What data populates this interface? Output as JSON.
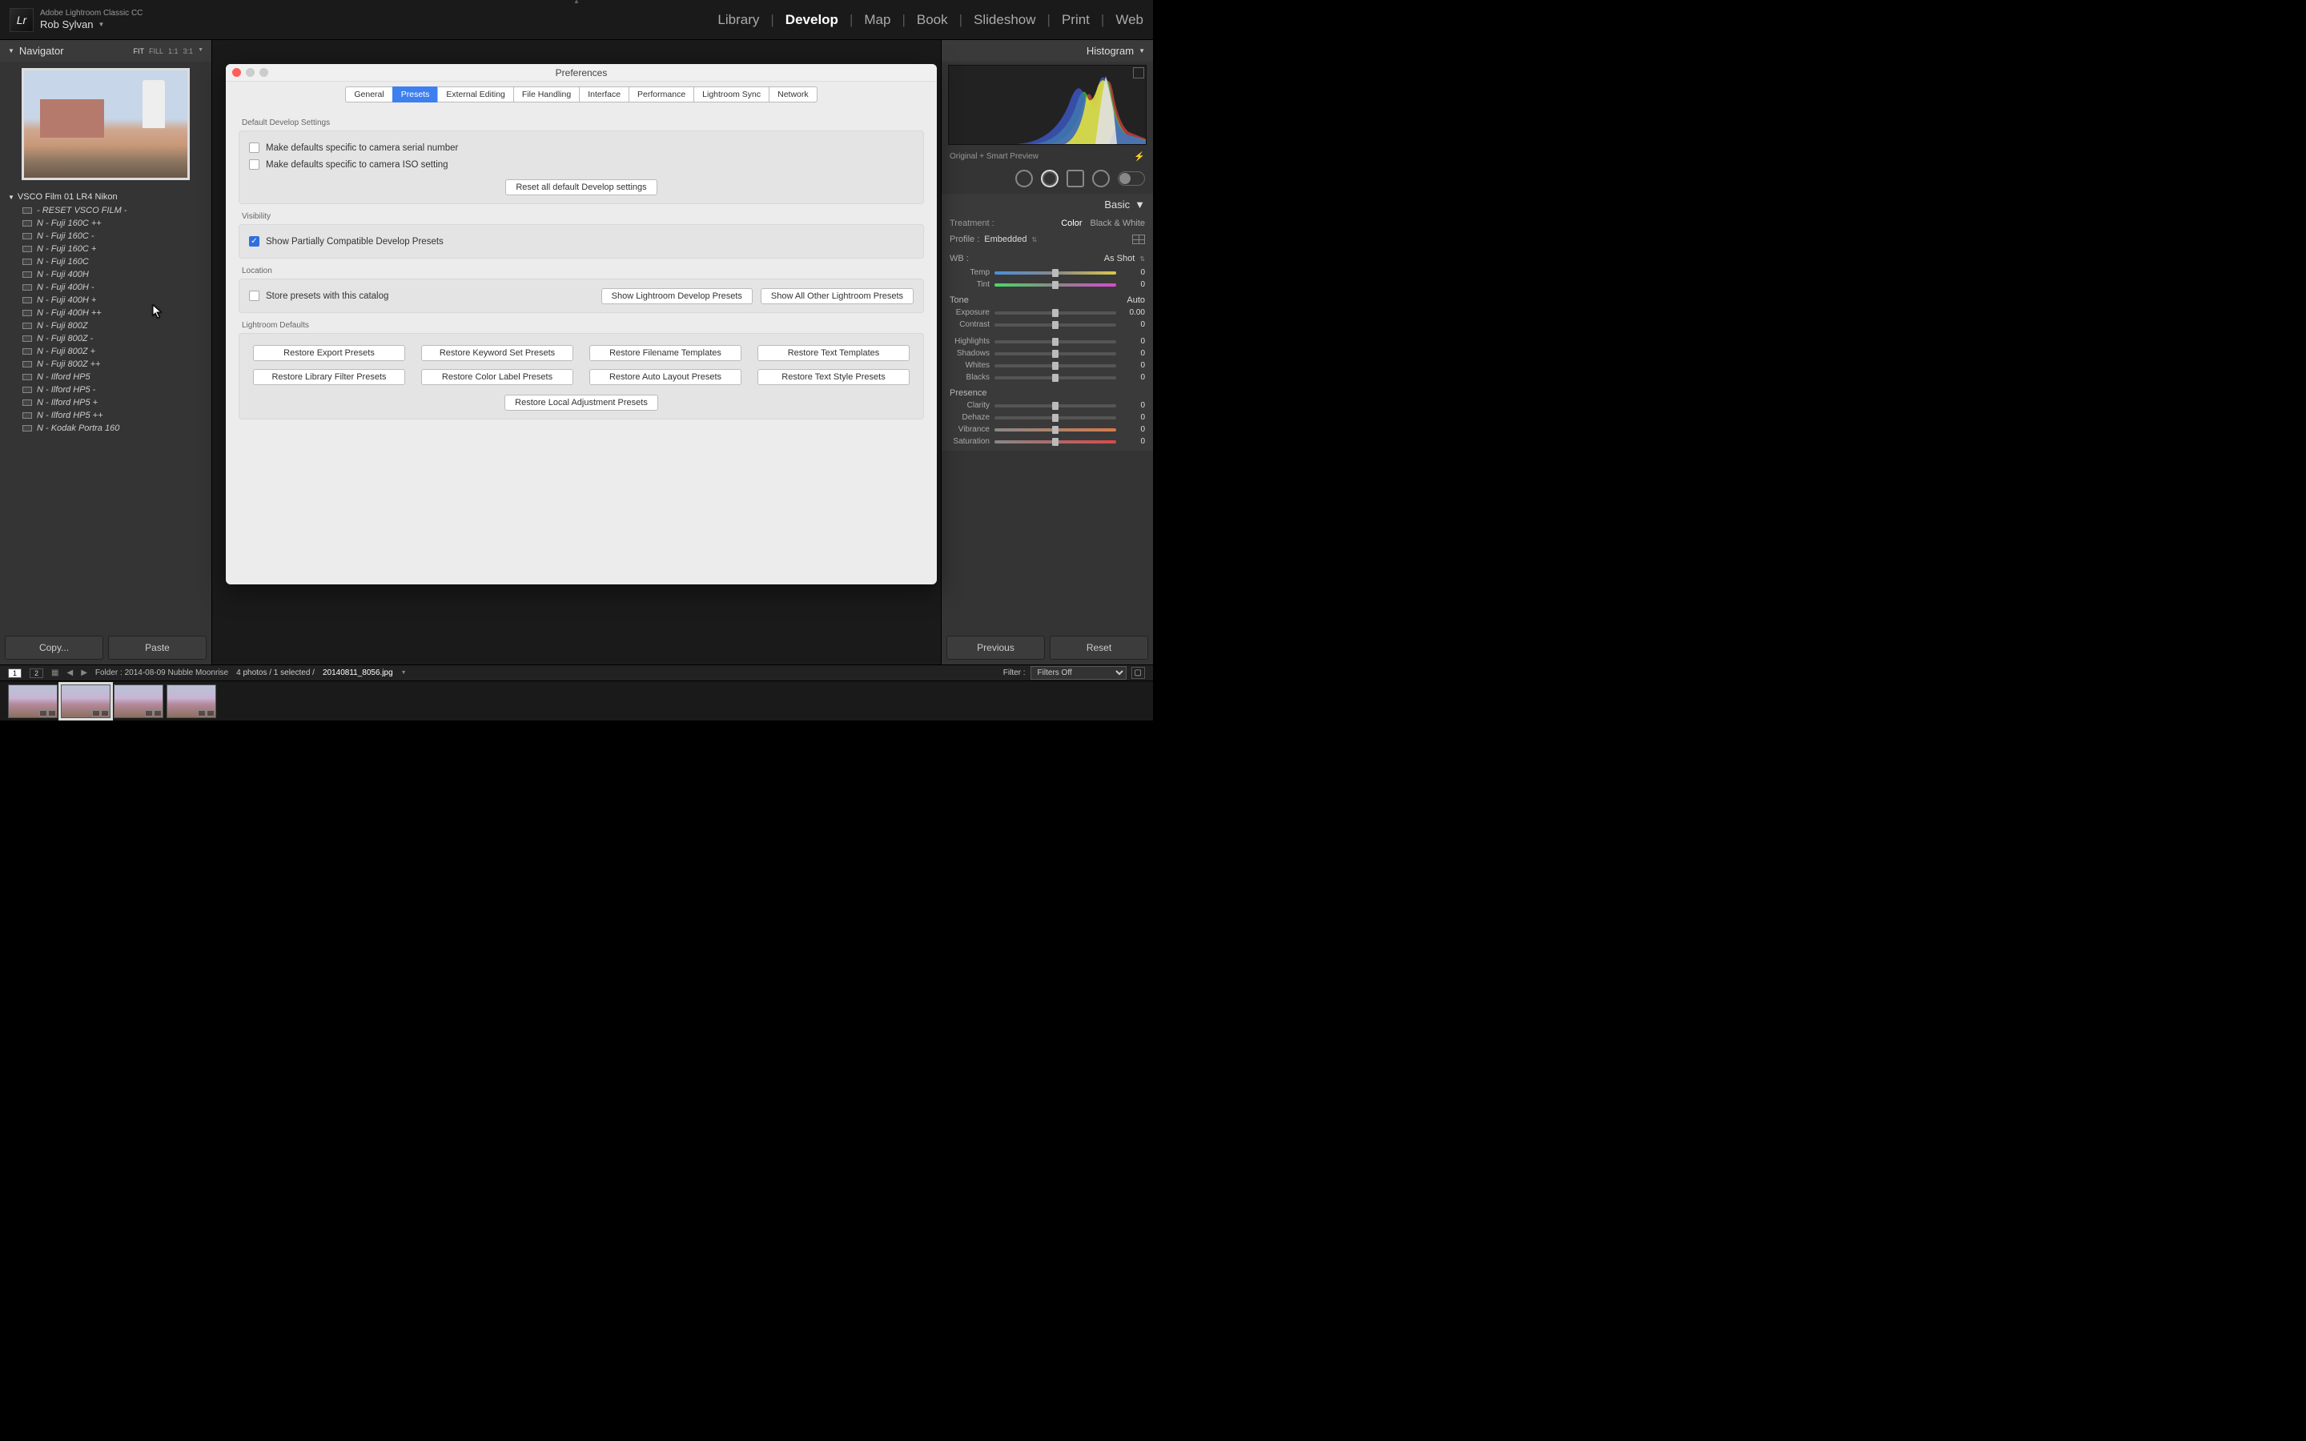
{
  "app": {
    "title": "Adobe Lightroom Classic CC",
    "user": "Rob Sylvan"
  },
  "modules": [
    "Library",
    "Develop",
    "Map",
    "Book",
    "Slideshow",
    "Print",
    "Web"
  ],
  "activeModule": "Develop",
  "navigator": {
    "title": "Navigator",
    "zooms": [
      "FIT",
      "FILL",
      "1:1",
      "3:1"
    ],
    "activeZoom": "FIT"
  },
  "presets": {
    "folder": "VSCO Film 01 LR4 Nikon",
    "items": [
      "- RESET VSCO FILM -",
      "N - Fuji 160C ++",
      "N - Fuji 160C -",
      "N - Fuji 160C +",
      "N - Fuji 160C",
      "N - Fuji 400H",
      "N - Fuji 400H -",
      "N - Fuji 400H +",
      "N - Fuji 400H ++",
      "N - Fuji 800Z",
      "N - Fuji 800Z -",
      "N - Fuji 800Z +",
      "N - Fuji 800Z ++",
      "N - Ilford HP5",
      "N - Ilford HP5 -",
      "N - Ilford HP5 +",
      "N - Ilford HP5 ++",
      "N - Kodak Portra 160"
    ]
  },
  "leftButtons": {
    "copy": "Copy...",
    "paste": "Paste"
  },
  "rightPanel": {
    "histogram": "Histogram",
    "previewLabel": "Original + Smart Preview",
    "basic": "Basic",
    "treatment": {
      "label": "Treatment :",
      "color": "Color",
      "bw": "Black & White"
    },
    "profile": {
      "label": "Profile :",
      "value": "Embedded"
    },
    "wb": {
      "label": "WB :",
      "value": "As Shot"
    },
    "toneHead": "Tone",
    "auto": "Auto",
    "presence": "Presence",
    "sliders": {
      "temp": {
        "label": "Temp",
        "value": "0"
      },
      "tint": {
        "label": "Tint",
        "value": "0"
      },
      "exposure": {
        "label": "Exposure",
        "value": "0.00"
      },
      "contrast": {
        "label": "Contrast",
        "value": "0"
      },
      "highlights": {
        "label": "Highlights",
        "value": "0"
      },
      "shadows": {
        "label": "Shadows",
        "value": "0"
      },
      "whites": {
        "label": "Whites",
        "value": "0"
      },
      "blacks": {
        "label": "Blacks",
        "value": "0"
      },
      "clarity": {
        "label": "Clarity",
        "value": "0"
      },
      "dehaze": {
        "label": "Dehaze",
        "value": "0"
      },
      "vibrance": {
        "label": "Vibrance",
        "value": "0"
      },
      "saturation": {
        "label": "Saturation",
        "value": "0"
      }
    },
    "previous": "Previous",
    "reset": "Reset"
  },
  "dialog": {
    "title": "Preferences",
    "tabs": [
      "General",
      "Presets",
      "External Editing",
      "File Handling",
      "Interface",
      "Performance",
      "Lightroom Sync",
      "Network"
    ],
    "activeTab": "Presets",
    "s1": {
      "head": "Default Develop Settings",
      "c1": "Make defaults specific to camera serial number",
      "c2": "Make defaults specific to camera ISO setting",
      "btn": "Reset all default Develop settings"
    },
    "s2": {
      "head": "Visibility",
      "c1": "Show Partially Compatible Develop Presets"
    },
    "s3": {
      "head": "Location",
      "c1": "Store presets with this catalog",
      "b1": "Show Lightroom Develop Presets",
      "b2": "Show All Other Lightroom Presets"
    },
    "s4": {
      "head": "Lightroom Defaults",
      "btns": [
        "Restore Export Presets",
        "Restore Keyword Set Presets",
        "Restore Filename Templates",
        "Restore Text Templates",
        "Restore Library Filter Presets",
        "Restore Color Label Presets",
        "Restore Auto Layout Presets",
        "Restore Text Style Presets"
      ],
      "last": "Restore Local Adjustment Presets"
    }
  },
  "filmstrip": {
    "screens": [
      "1",
      "2"
    ],
    "folder": "Folder : 2014-08-09 Nubble Moonrise",
    "count": "4 photos / 1 selected /",
    "file": "20140811_8056.jpg",
    "filterLabel": "Filter :",
    "filterValue": "Filters Off"
  }
}
